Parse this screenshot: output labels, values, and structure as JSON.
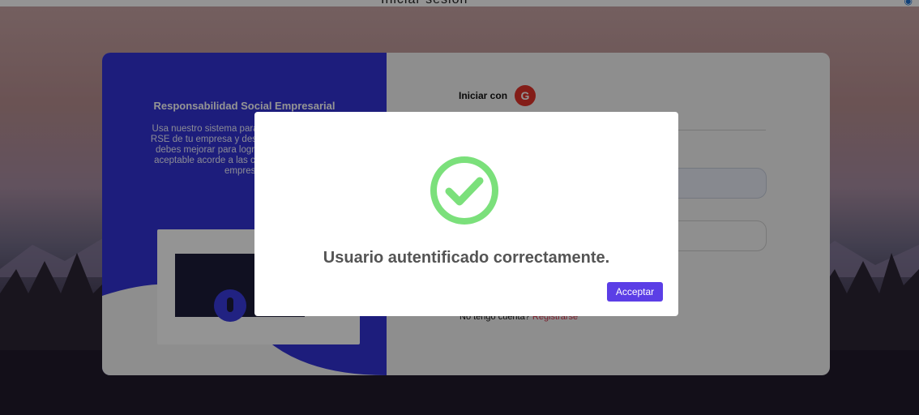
{
  "top_bar": {
    "title": "Iniciar sesión",
    "corner_icon": "help-icon"
  },
  "panel_left": {
    "title": "Responsabilidad Social Empresarial",
    "description": "Usa nuestro sistema para evaluar el nivel de RSE de tu empresa y descubre en que áreas debes mejorar para lograr un nivel de RSE aceptable acorde a las características de tu empresa."
  },
  "login": {
    "signin_label": "Iniciar con",
    "google_letter": "G",
    "no_account_label": "No tengo cuenta?",
    "register_link": "Registrarse"
  },
  "modal": {
    "icon": "success-check-icon",
    "message": "Usuario autentificado correctamente.",
    "accept_label": "Acceptar",
    "accent_color": "#5b3ee6",
    "success_color": "#7be07b"
  }
}
